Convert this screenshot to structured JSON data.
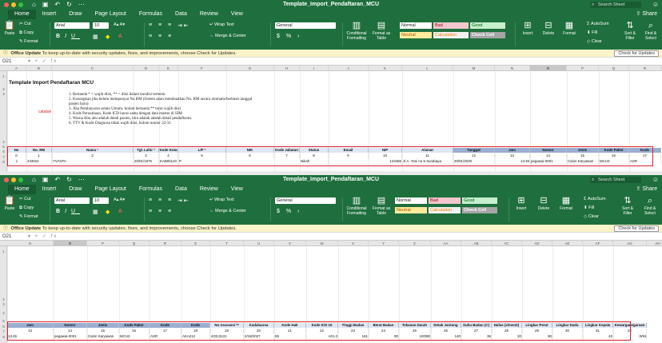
{
  "app": {
    "title": "Template_Import_Pendaftaran_MCU",
    "search_placeholder": "Search Sheet",
    "share_label": "Share"
  },
  "ribbon_tabs": [
    "Home",
    "Insert",
    "Draw",
    "Page Layout",
    "Formulas",
    "Data",
    "Review",
    "View"
  ],
  "ribbon": {
    "paste": "Paste",
    "cut": "Cut",
    "copy": "Copy",
    "format_painter": "Format",
    "font_name": "Arial",
    "font_size": "10",
    "wrap_text": "Wrap Text",
    "merge_center": "Merge & Center",
    "number_format": "General",
    "conditional_formatting": "Conditional Formatting",
    "format_as_table": "Format as Table",
    "styles": {
      "normal": "Normal",
      "bad": "Bad",
      "good": "Good",
      "neutral": "Neutral",
      "calculation": "Calculation",
      "check_cell": "Check Cell"
    },
    "insert": "Insert",
    "delete": "Delete",
    "format": "Format",
    "autosum": "AutoSum",
    "fill": "Fill",
    "clear": "Clear",
    "sort_filter": "Sort & Filter",
    "find_select": "Find & Select"
  },
  "update_bar": {
    "title": "Office Update",
    "message": "To keep up-to-date with security updates, fixes, and improvements, choose Check for Updates.",
    "button": "Check for Updates"
  },
  "formula_bar": {
    "name_box": "O21",
    "fx": "fx"
  },
  "sheet1": {
    "columns": [
      "A",
      "B",
      "C",
      "D",
      "E",
      "F",
      "G",
      "H",
      "I",
      "J",
      "K",
      "L",
      "M",
      "N",
      "O",
      "P",
      "Q",
      "R"
    ],
    "title": "Template Import Pendaftaran MCU",
    "catatan_label": "catatan",
    "notes": [
      "1. Bertanda * = wajib diisi, ** = diisi dalam kondisi tertentu",
      "2. Kosongkan jika belum mempunyai No RM (Sistem akan membuatkan No. RM secara otomatis/berbasis tanggal",
      "pasien baru)",
      "3. Jika Pembayaran selain Umum, kolom bertanda ** turut wajib diisi",
      "4. Kode Perusahaan, Kode ICD harus sama dengan data master di SIM",
      "5. Warna Abu abu adalah detail pasien, biru adalah adalah detail pendaftaran.",
      "6. TTV & Kode Diagnosa tidak wajib diisi, kolom nomor 22-31"
    ],
    "headers": [
      "No",
      "No. RM",
      "Nama *",
      "Tgl. Lahir *",
      "Kode Kota",
      "L/P *",
      "NIK",
      "Kode Jabatan",
      "Status",
      "Email",
      "NIP",
      "Alamat",
      "Tanggal",
      "Jam",
      "Nomor",
      "Jenis",
      "Kode Paket",
      "Kode"
    ],
    "numbers": [
      "0",
      "1",
      "2",
      "3",
      "4",
      "5",
      "6",
      "7",
      "8",
      "9",
      "10",
      "11",
      "12",
      "13",
      "14",
      "15",
      "16",
      "17"
    ],
    "row": [
      "1",
      "433022",
      "YVANTA",
      "",
      "20/01/1976",
      "KAB00123",
      "P",
      "",
      "",
      "Nikah",
      "",
      "123456",
      "Jl.A. Yani no 5 Surabaya",
      "20/01/2029",
      "13.45",
      "pegawai-0001",
      "Calon Karyawan",
      "MCU3",
      "ASR"
    ],
    "row_values": {
      "no": "1",
      "rm": "433022",
      "nama": "YVANTA",
      "tgl": "20/01/1976",
      "kota": "KAB00123",
      "lp": "P",
      "status": "Nikah",
      "nip": "123456",
      "alamat": "Jl.A. Yani no 5 Surabaya",
      "tanggal": "20/01/2029",
      "jam": "13.45",
      "nomor": "pegawai-0001",
      "jenis": "Calon Karyawan",
      "paket": "MCU3",
      "kode": "ASR"
    }
  },
  "sheet2": {
    "columns": [
      "N",
      "O",
      "P",
      "Q",
      "R",
      "S",
      "T",
      "U",
      "V",
      "W",
      "X",
      "Y",
      "Z",
      "AA",
      "AB",
      "AC",
      "AD",
      "AE",
      "AF",
      "AG",
      "AH"
    ],
    "headers": [
      "Jam",
      "Nomor",
      "Jenis",
      "Kode Paket",
      "Kode",
      "Kode",
      "No Asuransi **",
      "Kadaluarsa",
      "Kode Hak",
      "Kode ICD 10",
      "Tinggi Badan",
      "Berat Badan",
      "Tekanan Darah",
      "Detak Jantung",
      "Suhu Badan (C)",
      "Nafas (x/menit)",
      "Lingkar Perut",
      "Lingkar Dada",
      "Lingkar Kepala",
      "Kewarganegaraan"
    ],
    "numbers": [
      "13",
      "14",
      "15",
      "16",
      "17",
      "18",
      "19",
      "20",
      "21",
      "22",
      "23",
      "24",
      "25",
      "26",
      "27",
      "28",
      "29",
      "30",
      "31",
      "32"
    ],
    "row": [
      "13.45",
      "pegawai-0001",
      "Calon Karyawan",
      "MCU3",
      "ASR",
      "AKA212",
      "42313131",
      "2/18/2027",
      "55",
      "A01.2",
      "161",
      "80",
      "100/80",
      "140",
      "36",
      "20",
      "90",
      "",
      "42",
      "WNI"
    ]
  },
  "colors": {
    "excel_green": "#1e6f3d",
    "highlight_red": "#d8232a",
    "header_blue": "#dfe6f3",
    "header_blue_dark": "#9aaed1",
    "style_bad": "#f4c7ce",
    "style_good": "#c6efce",
    "style_neutral": "#ffeb9c",
    "style_calc": "#f2f2f2",
    "style_check": "#a5a5a5"
  },
  "icons": [
    "save-icon",
    "undo-icon",
    "redo-icon",
    "search-icon",
    "share-icon",
    "cut-icon",
    "copy-icon",
    "brush-icon",
    "bold-icon",
    "italic-icon",
    "underline-icon",
    "fill-color-icon",
    "font-color-icon",
    "align-icon",
    "wrap-icon",
    "merge-icon",
    "percent-icon",
    "sigma-icon",
    "sort-icon",
    "find-icon",
    "info-icon"
  ]
}
